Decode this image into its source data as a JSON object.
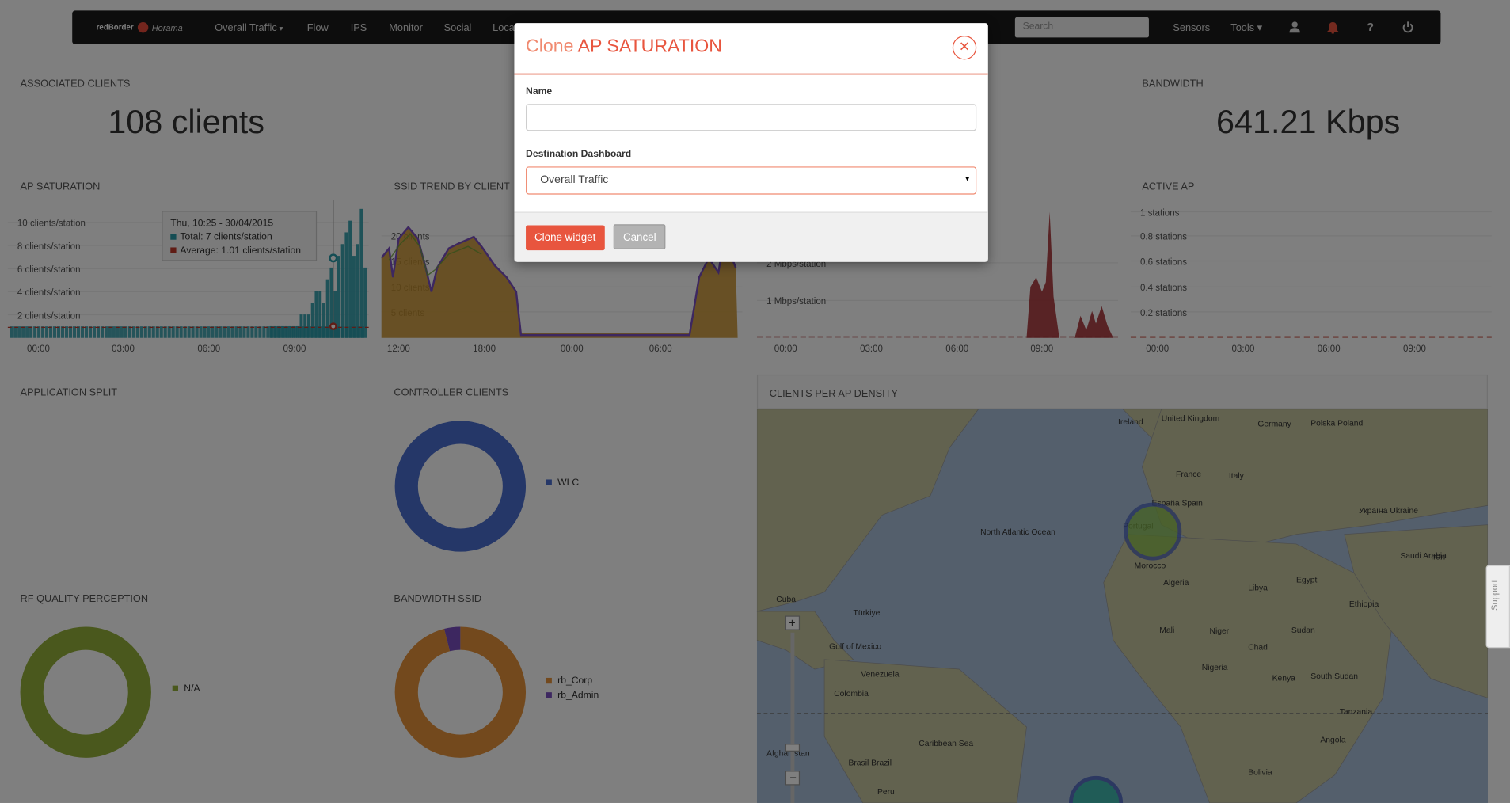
{
  "nav": {
    "brand": "redBorder",
    "brand_sub": "Horama",
    "items": [
      "Overall Traffic",
      "Flow",
      "IPS",
      "Monitor",
      "Social",
      "Location"
    ],
    "search_placeholder": "Search",
    "sensors": "Sensors",
    "tools": "Tools",
    "icons": [
      "user-icon",
      "bell-icon",
      "help-icon",
      "power-icon"
    ]
  },
  "widgets": {
    "associated_clients": {
      "title": "ASSOCIATED CLIENTS",
      "value": "108 clients"
    },
    "bandwidth": {
      "title": "BANDWIDTH",
      "value": "641.21 Kbps"
    },
    "ap_saturation": {
      "title": "AP SATURATION",
      "yticks": [
        "10 clients/station",
        "8 clients/station",
        "6 clients/station",
        "4 clients/station",
        "2 clients/station"
      ],
      "xticks": [
        "00:00",
        "03:00",
        "06:00",
        "09:00"
      ]
    },
    "ssid_trend": {
      "title": "SSID TREND BY CLIENT",
      "yticks": [
        "20 clients",
        "15 clients",
        "10 clients",
        "5 clients"
      ],
      "xticks": [
        "12:00",
        "18:00",
        "00:00",
        "06:00"
      ]
    },
    "traffic_chart": {
      "yticks": [
        "2 Mbps/station",
        "1 Mbps/station"
      ],
      "xticks": [
        "00:00",
        "03:00",
        "06:00",
        "09:00"
      ]
    },
    "active_ap": {
      "title": "ACTIVE AP",
      "yticks": [
        "1 stations",
        "0.8 stations",
        "0.6 stations",
        "0.4 stations",
        "0.2 stations"
      ],
      "xticks": [
        "00:00",
        "03:00",
        "06:00",
        "09:00"
      ]
    },
    "application_split": {
      "title": "APPLICATION SPLIT"
    },
    "controller_clients": {
      "title": "CONTROLLER CLIENTS",
      "legend": [
        "WLC"
      ]
    },
    "clients_per_ap_density": {
      "title": "CLIENTS PER AP DENSITY"
    },
    "rf_quality": {
      "title": "RF QUALITY PERCEPTION",
      "legend": [
        "N/A"
      ]
    },
    "bandwidth_ssid": {
      "title": "BANDWIDTH SSID",
      "legend": [
        "rb_Corp",
        "rb_Admin"
      ]
    }
  },
  "tooltip": {
    "date": "Thu, 10:25 - 30/04/2015",
    "total": "Total: 7 clients/station",
    "average": "Average: 1.01 clients/station"
  },
  "map_labels": [
    "North Atlantic Ocean",
    "Portugal",
    "España Spain",
    "Morocco",
    "Algeria",
    "Libya",
    "Egypt",
    "Mali",
    "Niger",
    "Chad",
    "Sudan",
    "Nigeria",
    "Venezuela",
    "Colombia",
    "Ireland",
    "United Kingdom",
    "France",
    "Italy",
    "Germany",
    "Polska Poland",
    "Україна Ukraine",
    "Türkiye",
    "Cuba",
    "Gulf of Mexico",
    "Caribbean Sea",
    "Brasil Brazil",
    "Peru",
    "Bolivia",
    "Angola",
    "Tanzania",
    "Kenya",
    "South Sudan",
    "Ethiopia",
    "Saudi Arabia",
    "Iran",
    "Afghanistan"
  ],
  "modal": {
    "title_prefix": "Clone",
    "title_widget": "AP SATURATION",
    "name_label": "Name",
    "name_value": "",
    "dest_label": "Destination Dashboard",
    "dest_value": "Overall Traffic",
    "clone_button": "Clone widget",
    "cancel_button": "Cancel"
  },
  "support_label": "Support",
  "colors": {
    "accent": "#e8553e",
    "teal": "#2a9aa8",
    "orange": "#e6923a",
    "purple": "#7a4fc0",
    "crimson": "#a3262a",
    "blue": "#4a6ed0",
    "olive": "#94b13a"
  },
  "chart_data": [
    {
      "type": "bar",
      "title": "AP SATURATION",
      "ylabel": "clients/station",
      "ylim": [
        0,
        11
      ],
      "x": [
        "00:00",
        "03:00",
        "06:00",
        "09:00"
      ],
      "series": [
        {
          "name": "Total",
          "values": [
            1,
            1,
            1,
            1,
            1,
            1,
            1,
            1,
            2,
            2,
            2,
            3,
            4,
            4,
            3,
            5,
            6,
            4,
            7,
            8,
            9,
            10,
            7,
            8,
            11,
            6
          ]
        },
        {
          "name": "Average",
          "values": [
            1.01
          ]
        }
      ]
    },
    {
      "type": "area",
      "title": "SSID TREND BY CLIENT",
      "x": [
        "12:00",
        "18:00",
        "00:00",
        "06:00"
      ],
      "ylim": [
        0,
        22
      ]
    },
    {
      "type": "area",
      "ylabel": "Mbps/station",
      "x": [
        "00:00",
        "03:00",
        "06:00",
        "09:00"
      ],
      "ylim": [
        0,
        3
      ]
    },
    {
      "type": "line",
      "title": "ACTIVE AP",
      "ylabel": "stations",
      "ylim": [
        0,
        1
      ],
      "x": [
        "00:00",
        "03:00",
        "06:00",
        "09:00"
      ]
    },
    {
      "type": "pie",
      "title": "CONTROLLER CLIENTS",
      "categories": [
        "WLC"
      ],
      "values": [
        100
      ]
    },
    {
      "type": "pie",
      "title": "RF QUALITY PERCEPTION",
      "categories": [
        "N/A"
      ],
      "values": [
        100
      ]
    },
    {
      "type": "pie",
      "title": "BANDWIDTH SSID",
      "categories": [
        "rb_Corp",
        "rb_Admin"
      ],
      "values": [
        96,
        4
      ]
    }
  ]
}
